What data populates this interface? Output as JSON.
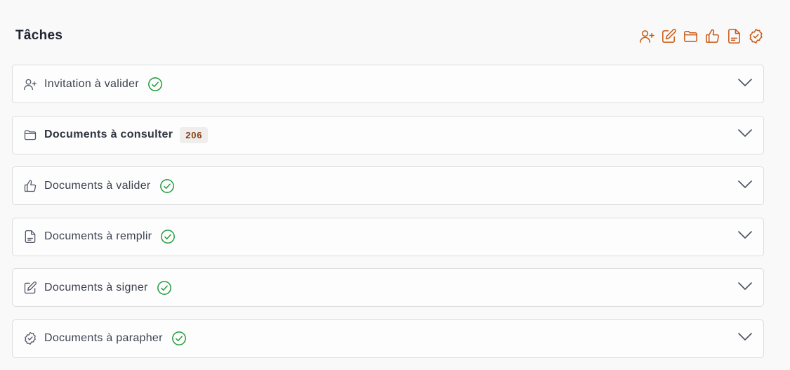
{
  "header": {
    "title": "Tâches",
    "toolbar": [
      "user-plus-icon",
      "pencil-edit-icon",
      "folder-icon",
      "thumbs-up-icon",
      "document-icon",
      "badge-check-icon"
    ]
  },
  "colors": {
    "accent": "#c85a15",
    "success": "#1f9a3a",
    "text": "#3d4250",
    "badge_text": "#8a3d10",
    "badge_bg": "#f0eeec"
  },
  "tasks": [
    {
      "label": "Invitation à valider",
      "icon": "user-plus-icon",
      "status": "check"
    },
    {
      "label": "Documents à consulter",
      "icon": "folder-icon",
      "count": "206"
    },
    {
      "label": "Documents à valider",
      "icon": "thumbs-up-icon",
      "status": "check"
    },
    {
      "label": "Documents à remplir",
      "icon": "document-icon",
      "status": "check"
    },
    {
      "label": "Documents à signer",
      "icon": "pencil-edit-icon",
      "status": "check"
    },
    {
      "label": "Documents à parapher",
      "icon": "badge-check-icon",
      "status": "check"
    }
  ]
}
